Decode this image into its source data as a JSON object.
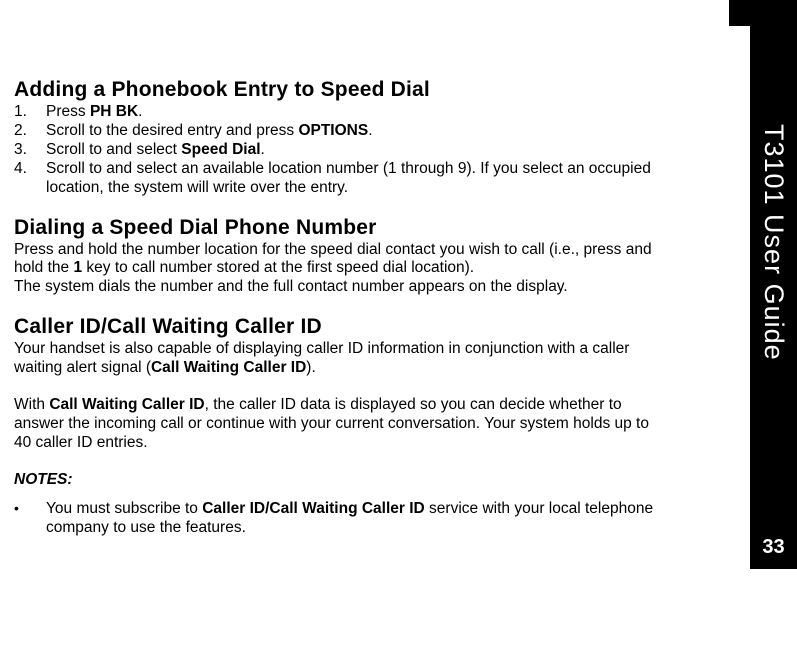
{
  "sidebar": {
    "title": "T3101 User Guide",
    "page_number": "33"
  },
  "sections": {
    "adding": {
      "heading": "Adding a Phonebook Entry to Speed Dial",
      "steps": [
        {
          "num": "1.",
          "pre": "Press ",
          "bold1": "PH BK",
          "post": "."
        },
        {
          "num": "2.",
          "pre": "Scroll to the desired entry and press ",
          "bold1": "OPTIONS",
          "post": "."
        },
        {
          "num": "3.",
          "pre": "Scroll to and select ",
          "bold1": "Speed Dial",
          "post": "."
        },
        {
          "num": "4.",
          "pre": "Scroll to and select an available location number (1 through 9). If you select an occupied location, the system will write over the entry.",
          "bold1": "",
          "post": ""
        }
      ]
    },
    "dialing": {
      "heading": "Dialing a Speed Dial Phone Number",
      "para1_pre": "Press and hold the number location for the speed dial contact you wish to call (i.e., press and hold the ",
      "para1_bold": "1",
      "para1_post": " key to call number stored at the first speed dial location).",
      "para2": "The system dials the number and the full contact number appears on the display."
    },
    "callerid": {
      "heading": "Caller ID/Call Waiting Caller ID",
      "para1_pre": "Your handset is also capable of displaying caller ID information in conjunction with a caller waiting alert signal (",
      "para1_bold": "Call Waiting Caller ID",
      "para1_post": ").",
      "para2_pre": "With ",
      "para2_bold": "Call Waiting Caller ID",
      "para2_post": ", the caller ID data is displayed so you can decide whether to answer the incoming call or continue with your current conversation. Your system holds up to 40 caller ID entries.",
      "notes_label": "NOTES:",
      "note1_pre": "You must subscribe to ",
      "note1_bold": "Caller ID/Call Waiting Caller ID",
      "note1_post": " service with your local telephone company to use the features."
    }
  }
}
